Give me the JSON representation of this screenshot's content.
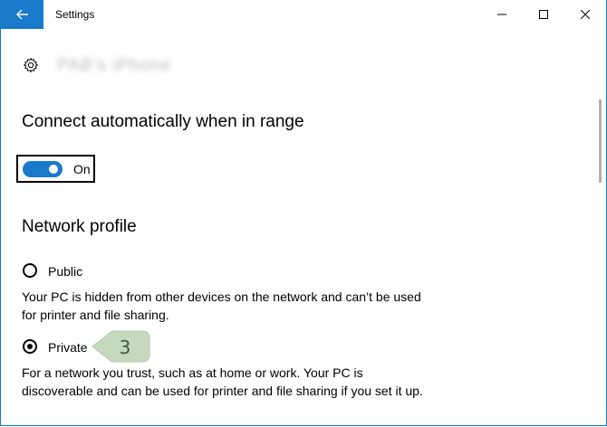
{
  "window": {
    "title": "Settings"
  },
  "network": {
    "name": "PAB's iPhone"
  },
  "connect": {
    "heading": "Connect automatically when in range",
    "toggle_state": "On"
  },
  "profile": {
    "heading": "Network profile",
    "public_label": "Public",
    "public_desc": "Your PC is hidden from other devices on the network and can’t be used for printer and file sharing.",
    "private_label": "Private",
    "private_desc": "For a network you trust, such as at home or work. Your PC is discoverable and can be used for printer and file sharing if you set it up."
  },
  "annotation": {
    "step": "3"
  },
  "colors": {
    "accent": "#1979ca",
    "callout_fill": "#c6d9bf",
    "callout_text": "#3b5a3b"
  }
}
